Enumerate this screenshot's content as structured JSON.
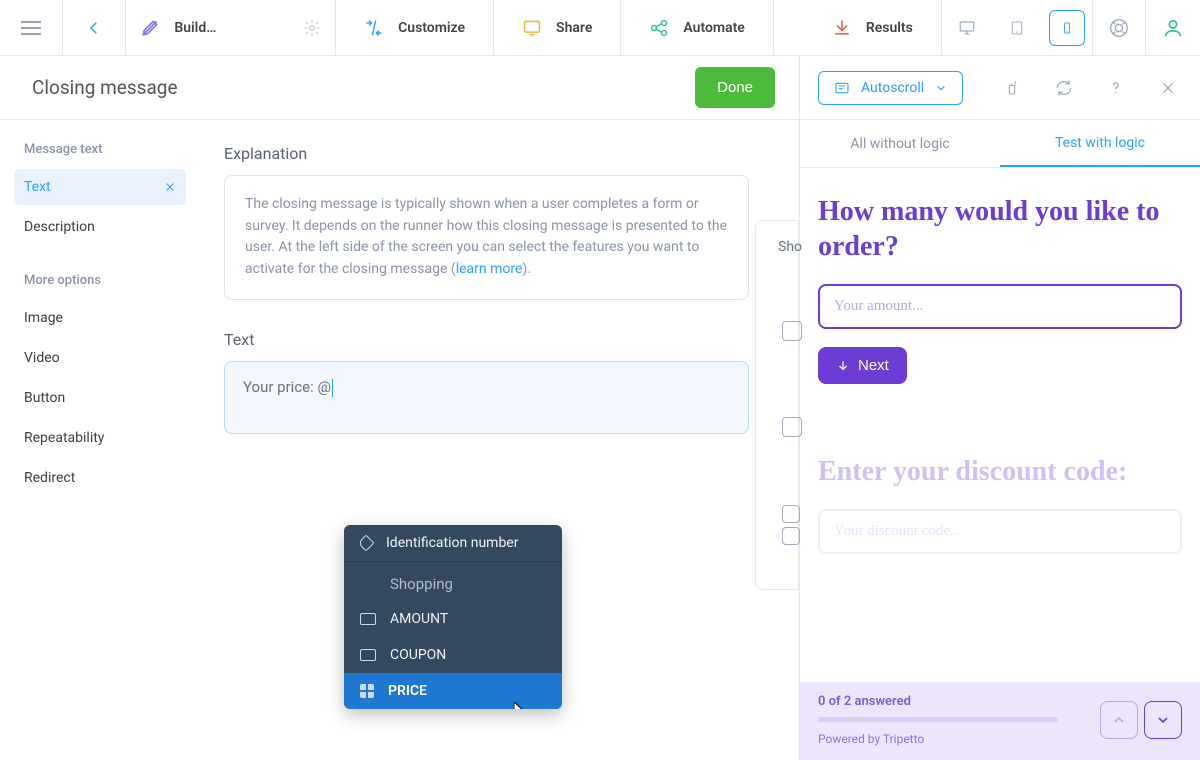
{
  "topbar": {
    "build_label": "Build…",
    "nav": [
      "Customize",
      "Share",
      "Automate"
    ],
    "results_label": "Results"
  },
  "left": {
    "title": "Closing message",
    "done_label": "Done",
    "sidebar": {
      "section1_label": "Message text",
      "items1": [
        "Text",
        "Description"
      ],
      "section2_label": "More options",
      "items2": [
        "Image",
        "Video",
        "Button",
        "Repeatability",
        "Redirect"
      ]
    },
    "editor": {
      "explanation_label": "Explanation",
      "explanation_body_a": "The closing message is typically shown when a user completes a form or survey. It depends on the runner how this closing message is presented to the user. At the left side of the screen you can select the features you want to activate for the closing message (",
      "explanation_link": "learn more",
      "explanation_body_b": ").",
      "text_label": "Text",
      "text_value": "Your price: @"
    },
    "dropdown": {
      "top_item": "Identification number",
      "group_label": "Shopping",
      "items": [
        "AMOUNT",
        "COUPON",
        "PRICE"
      ],
      "selected_index": 2
    },
    "peek_label": "Sho"
  },
  "right": {
    "autoscroll_label": "Autoscroll",
    "tabs": [
      "All without logic",
      "Test with logic"
    ],
    "active_tab": 1,
    "preview": {
      "q1_title": "How many would you like to order?",
      "q1_placeholder": "Your amount...",
      "next_label": "Next",
      "q2_title": "Enter your discount code:",
      "q2_placeholder": "Your discount code..."
    },
    "footer": {
      "answered": "0 of 2 answered",
      "brand": "Powered by Tripetto"
    }
  }
}
